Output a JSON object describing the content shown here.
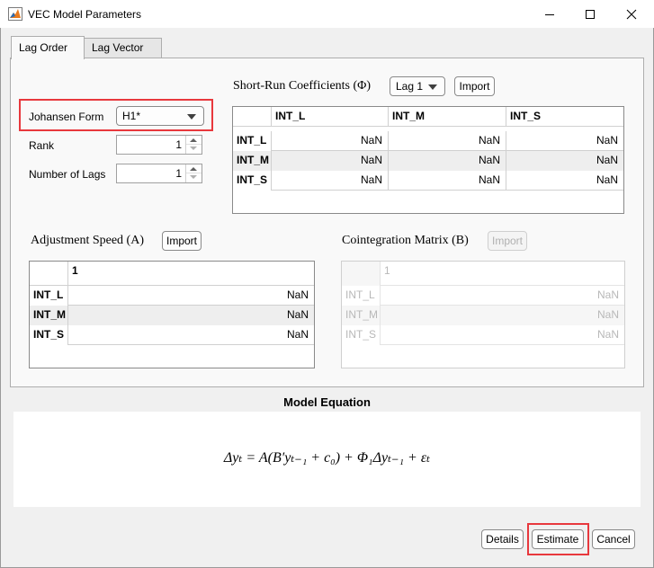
{
  "window": {
    "title": "VEC Model Parameters"
  },
  "tabs": [
    {
      "label": "Lag Order"
    },
    {
      "label": "Lag Vector"
    }
  ],
  "left": {
    "johansen_label": "Johansen Form",
    "johansen_value": "H1*",
    "rank_label": "Rank",
    "rank_value": "1",
    "lags_label": "Number of Lags",
    "lags_value": "1"
  },
  "short_run": {
    "title": "Short-Run  Coefficients  (Φ)",
    "lag_select": "Lag 1",
    "import_label": "Import",
    "columns": [
      "INT_L",
      "INT_M",
      "INT_S"
    ],
    "rows": [
      {
        "name": "INT_L",
        "values": [
          "NaN",
          "NaN",
          "NaN"
        ]
      },
      {
        "name": "INT_M",
        "values": [
          "NaN",
          "NaN",
          "NaN"
        ]
      },
      {
        "name": "INT_S",
        "values": [
          "NaN",
          "NaN",
          "NaN"
        ]
      }
    ]
  },
  "adjustment": {
    "title": "Adjustment  Speed  (A)",
    "import_label": "Import",
    "columns": [
      "1"
    ],
    "rows": [
      {
        "name": "INT_L",
        "values": [
          "NaN"
        ]
      },
      {
        "name": "INT_M",
        "values": [
          "NaN"
        ]
      },
      {
        "name": "INT_S",
        "values": [
          "NaN"
        ]
      }
    ]
  },
  "cointegration": {
    "title": "Cointegration  Matrix  (B)",
    "import_label": "Import",
    "columns": [
      "1"
    ],
    "rows": [
      {
        "name": "INT_L",
        "values": [
          "NaN"
        ]
      },
      {
        "name": "INT_M",
        "values": [
          "NaN"
        ]
      },
      {
        "name": "INT_S",
        "values": [
          "NaN"
        ]
      }
    ]
  },
  "equation": {
    "title": "Model Equation",
    "formula": "Δyₜ = A(B′yₜ₋₁ + c₀) + Φ₁Δyₜ₋₁ + εₜ"
  },
  "footer": {
    "details_label": "Details",
    "estimate_label": "Estimate",
    "cancel_label": "Cancel"
  },
  "colors": {
    "highlight": "#e8383d",
    "panel": "#f9f9f9",
    "window_bg": "#f0f0f0"
  }
}
